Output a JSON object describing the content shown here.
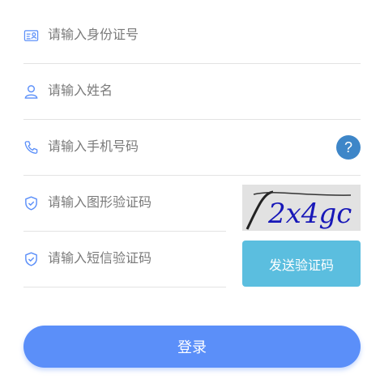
{
  "form": {
    "id_card": {
      "placeholder": "请输入身份证号",
      "icon": "id-card-icon"
    },
    "name": {
      "placeholder": "请输入姓名",
      "icon": "user-icon"
    },
    "phone": {
      "placeholder": "请输入手机号码",
      "icon": "phone-icon",
      "help_label": "?"
    },
    "captcha": {
      "placeholder": "请输入图形验证码",
      "icon": "shield-check-icon",
      "image_text": "2x4gc"
    },
    "sms_code": {
      "placeholder": "请输入短信验证码",
      "icon": "shield-check-icon",
      "send_label": "发送验证码"
    }
  },
  "login": {
    "label": "登录"
  },
  "colors": {
    "primary": "#5b8ff9",
    "icon": "#5b8ff9",
    "help": "#3e86c8",
    "sms_button": "#5bbedf",
    "divider": "#e3e3e3"
  }
}
